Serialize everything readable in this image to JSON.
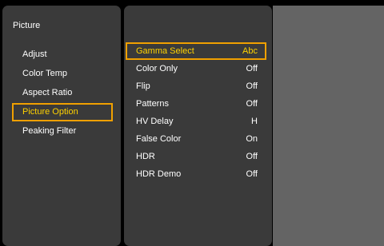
{
  "menu": {
    "title": "Picture",
    "items": [
      {
        "label": "Adjust"
      },
      {
        "label": "Color Temp"
      },
      {
        "label": "Aspect Ratio"
      },
      {
        "label": "Picture Option"
      },
      {
        "label": "Peaking Filter"
      }
    ],
    "selected_index": 3
  },
  "submenu": {
    "items": [
      {
        "label": "Gamma Select",
        "value": "Abc"
      },
      {
        "label": "Color Only",
        "value": "Off"
      },
      {
        "label": "Flip",
        "value": "Off"
      },
      {
        "label": "Patterns",
        "value": "Off"
      },
      {
        "label": "HV Delay",
        "value": "H"
      },
      {
        "label": "False Color",
        "value": "On"
      },
      {
        "label": "HDR",
        "value": "Off"
      },
      {
        "label": "HDR Demo",
        "value": "Off"
      }
    ],
    "selected_index": 0
  },
  "colors": {
    "panel_bg": "#3a3a3a",
    "preview_bg": "#646464",
    "highlight_border": "#f0a000",
    "highlight_text": "#ffd200"
  }
}
